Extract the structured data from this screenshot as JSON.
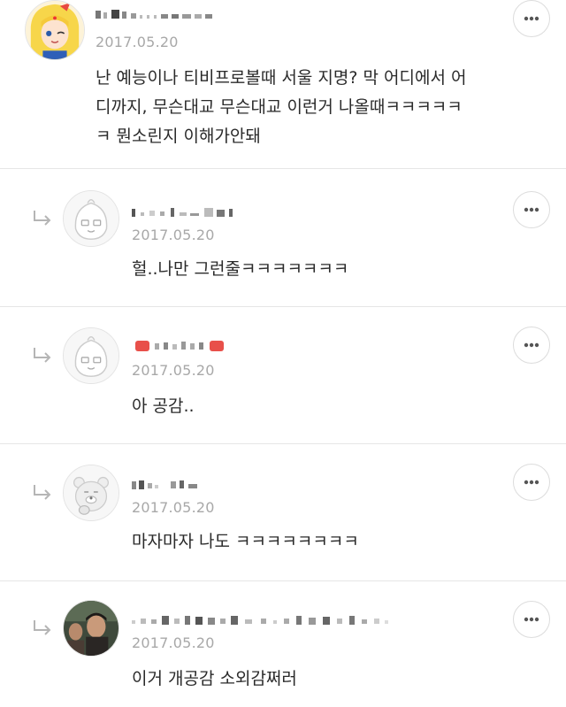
{
  "comments": [
    {
      "nickname_hidden": true,
      "date": "2017.05.20",
      "text_lines": [
        "난 예능이나 티비프로볼때 서울 지명? 막 어디에서 어",
        "디까지, 무슨대교 무슨대교 이런거 나올때ㅋㅋㅋㅋㅋ",
        "ㅋ 뭔소린지 이해가안돼"
      ],
      "avatar": "sailor-moon-avatar",
      "is_reply": false
    },
    {
      "nickname_hidden": true,
      "date": "2017.05.20",
      "text_lines": [
        "헐..나만 그런줄ㅋㅋㅋㅋㅋㅋㅋ"
      ],
      "avatar": "default-peach-avatar",
      "is_reply": true
    },
    {
      "nickname_hidden": true,
      "date": "2017.05.20",
      "text_lines": [
        "아 공감.."
      ],
      "avatar": "default-peach-avatar",
      "is_reply": true
    },
    {
      "nickname_hidden": true,
      "date": "2017.05.20",
      "text_lines": [
        "마자마자 나도 ㅋㅋㅋㅋㅋㅋㅋㅋ"
      ],
      "avatar": "default-ryan-avatar",
      "is_reply": true
    },
    {
      "nickname_hidden": true,
      "date": "2017.05.20",
      "text_lines": [
        "이거 개공감 소외감쩌러"
      ],
      "avatar": "photo-avatar",
      "is_reply": true
    }
  ],
  "icons": {
    "more": "more-options-icon",
    "reply": "reply-arrow-icon"
  },
  "colors": {
    "divider": "#e6e6e6",
    "date": "#a8a8a8",
    "text": "#2a2a2a"
  }
}
